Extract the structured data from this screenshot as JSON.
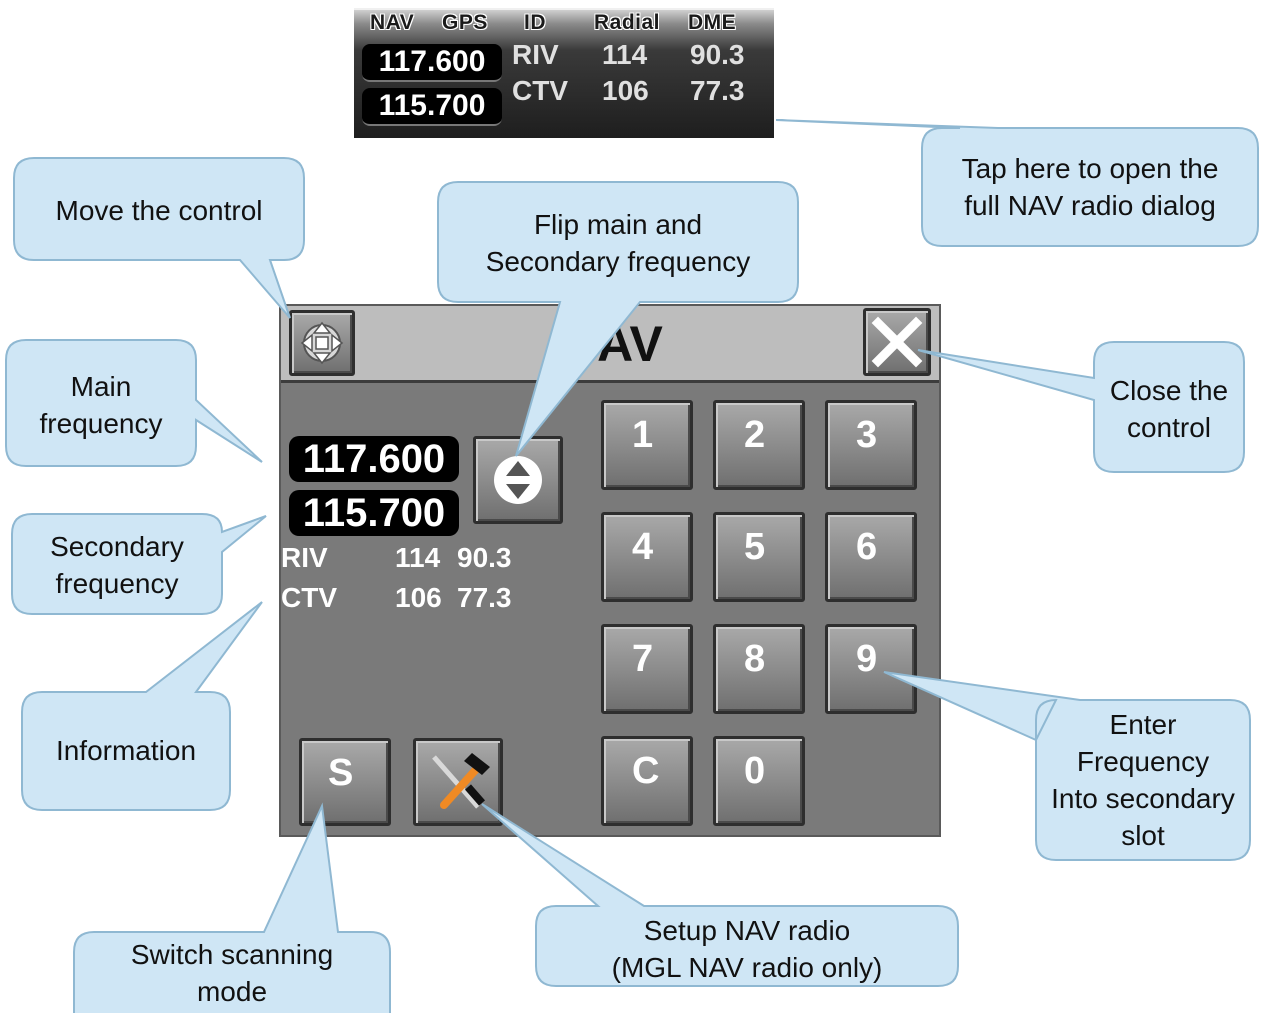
{
  "mini_bar": {
    "headers": [
      "NAV",
      "GPS",
      "ID",
      "Radial",
      "DME"
    ],
    "main_freq": "117.600",
    "secondary_freq": "115.700",
    "rows": [
      {
        "id": "RIV",
        "radial": "114",
        "dme": "90.3"
      },
      {
        "id": "CTV",
        "radial": "106",
        "dme": "77.3"
      }
    ]
  },
  "dialog": {
    "title": "NAV",
    "main_freq": "117.600",
    "secondary_freq": "115.700",
    "info_rows": [
      {
        "id": "RIV",
        "radial": "114",
        "dme": "90.3"
      },
      {
        "id": "CTV",
        "radial": "106",
        "dme": "77.3"
      }
    ],
    "keypad": [
      "1",
      "2",
      "3",
      "4",
      "5",
      "6",
      "7",
      "8",
      "9",
      "C",
      "0"
    ],
    "scan_label": "S"
  },
  "callouts": {
    "tap_here": [
      "Tap here to open the",
      "full NAV radio dialog"
    ],
    "move": [
      "Move the control"
    ],
    "flip": [
      "Flip main and",
      "Secondary frequency"
    ],
    "close": [
      "Close the",
      "control"
    ],
    "main_freq": [
      "Main",
      "frequency"
    ],
    "secondary_freq": [
      "Secondary",
      "frequency"
    ],
    "information": [
      "Information"
    ],
    "enter_freq": [
      "Enter",
      "Frequency",
      "Into secondary",
      "slot"
    ],
    "scan": [
      "Switch scanning",
      "mode"
    ],
    "setup": [
      "Setup NAV radio",
      "(MGL NAV radio only)"
    ]
  },
  "colors": {
    "callout_fill": "#cfe6f5",
    "callout_stroke": "#8fb8d2",
    "dialog_bg": "#7a7a7a",
    "freq_bg": "#000000"
  }
}
